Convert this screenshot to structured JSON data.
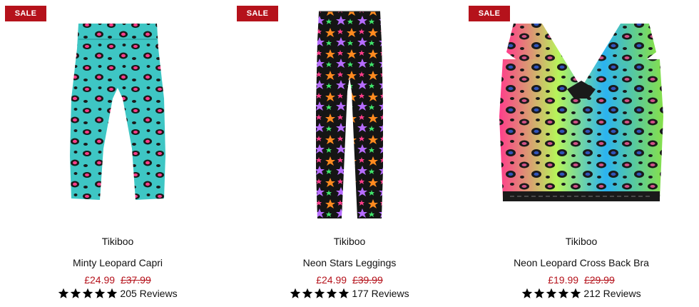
{
  "products": [
    {
      "badge": "SALE",
      "brand": "Tikiboo",
      "name": "Minty Leopard Capri",
      "price_now": "£24.99",
      "price_was": "£37.99",
      "rating": 5,
      "reviews_text": "205 Reviews",
      "image": "capri-leggings-image"
    },
    {
      "badge": "SALE",
      "brand": "Tikiboo",
      "name": "Neon Stars Leggings",
      "price_now": "£24.99",
      "price_was": "£39.99",
      "rating": 5,
      "reviews_text": "177 Reviews",
      "image": "leggings-image"
    },
    {
      "badge": "SALE",
      "brand": "Tikiboo",
      "name": "Neon Leopard Cross Back Bra",
      "price_now": "£19.99",
      "price_was": "£29.99",
      "rating": 5,
      "reviews_text": "212 Reviews",
      "image": "sports-bra-image"
    }
  ],
  "colors": {
    "sale_badge": "#b5121b",
    "price": "#b5121b",
    "text": "#111111",
    "star": "#000000"
  }
}
